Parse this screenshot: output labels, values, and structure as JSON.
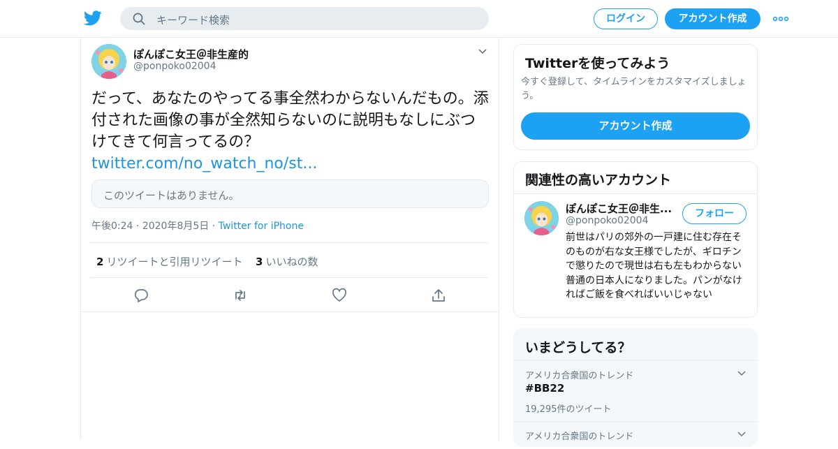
{
  "header": {
    "search_placeholder": "キーワード検索",
    "login_label": "ログイン",
    "signup_label": "アカウント作成"
  },
  "tweet": {
    "display_name": "ぽんぽこ女王＠非生産的",
    "handle": "@ponpoko02004",
    "text": "だって、あなたのやってる事全然わからないんだもの。添付された画像の事が全然知らないのに説明もなしにぶつけてきて何言ってるの？",
    "link": "twitter.com/no_watch_no/st...",
    "quote_unavailable": "このツイートはありません。",
    "time": "午後0:24",
    "date": "2020年8月5日",
    "source": "Twitter for iPhone",
    "retweets_count": "2",
    "retweets_label": "リツイートと引用リツイート",
    "likes_count": "3",
    "likes_label": "いいねの数"
  },
  "signup_card": {
    "title": "Twitterを使ってみよう",
    "description": "今すぐ登録して、タイムラインをカスタマイズしましょう。",
    "button": "アカウント作成"
  },
  "related": {
    "title": "関連性の高いアカウント",
    "name": "ぽんぽこ女王＠非生...",
    "handle": "@ponpoko02004",
    "follow_label": "フォロー",
    "bio": "前世はパリの郊外の一戸建に住む存在そのものが右な女王様でしたが、ギロチンで懲りたので現世は右も左もわからない普通の日本人になりました。パンがなければご飯を食べればいいじゃない"
  },
  "trends": {
    "title": "いまどうしてる？",
    "items": [
      {
        "context": "アメリカ合衆国のトレンド",
        "name": "#BB22",
        "count": "19,295件のツイート"
      },
      {
        "context": "アメリカ合衆国のトレンド"
      }
    ]
  },
  "colors": {
    "accent": "#1da1f2",
    "link": "#1b95e0",
    "secondary_text": "#657786"
  }
}
